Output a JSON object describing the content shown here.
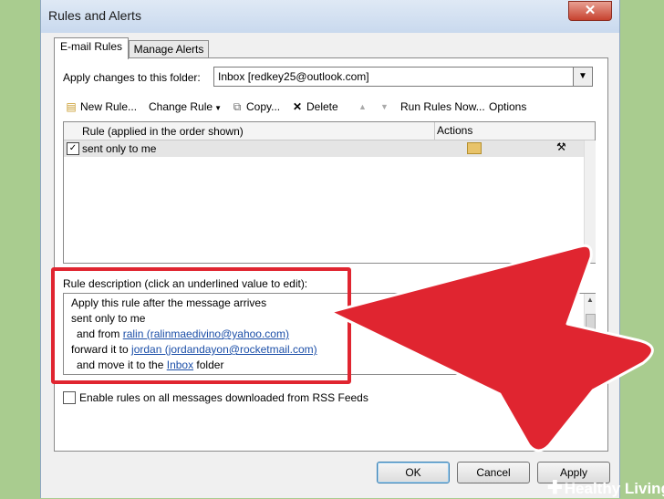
{
  "window": {
    "title": "Rules and Alerts",
    "close_glyph": "✕"
  },
  "tabs": [
    {
      "label": "E-mail Rules"
    },
    {
      "label": "Manage Alerts"
    }
  ],
  "folder": {
    "label": "Apply changes to this folder:",
    "value": "Inbox [redkey25@outlook.com]"
  },
  "toolbar": {
    "new_rule": "New Rule...",
    "change_rule": "Change Rule",
    "copy": "Copy...",
    "delete": "Delete",
    "run_rules": "Run Rules Now...",
    "options": "Options"
  },
  "rules_list": {
    "columns": [
      "Rule (applied in the order shown)",
      "Actions"
    ],
    "rows": [
      {
        "name": "sent only to me",
        "checked": true
      }
    ]
  },
  "description": {
    "label": "Rule description (click an underlined value to edit):",
    "line1": "Apply this rule after the message arrives",
    "line2": "sent only to me",
    "line3_pre": "and from ",
    "line3_link": "ralin (ralinmaedivino@yahoo.com)",
    "line4_pre": "forward it to ",
    "line4_link": "jordan (jordandayon@rocketmail.com)",
    "line5_pre": "and move it to the ",
    "line5_link": "Inbox",
    "line5_post": " folder"
  },
  "rss": {
    "label": "Enable rules on all messages downloaded from RSS Feeds",
    "checked": false
  },
  "buttons": {
    "ok": "OK",
    "cancel": "Cancel",
    "apply": "Apply"
  },
  "watermark": {
    "text": "Healthy Living",
    "plus": "✚"
  },
  "colors": {
    "highlight": "#e02530",
    "arrow": "#e02530",
    "background": "#a9cc8f",
    "link": "#1c4fa8"
  }
}
